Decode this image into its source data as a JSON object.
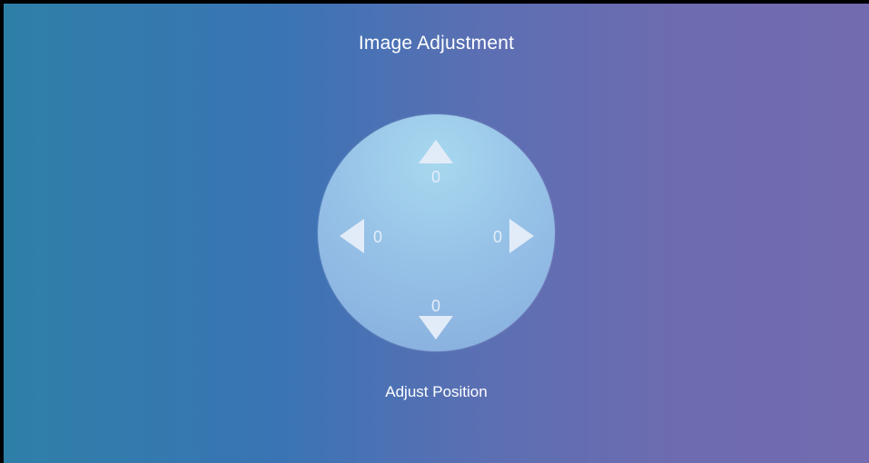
{
  "header": {
    "title": "Image Adjustment"
  },
  "position_pad": {
    "up_value": "0",
    "down_value": "0",
    "left_value": "0",
    "right_value": "0",
    "caption": "Adjust Position"
  },
  "icons": {
    "up": "triangle-up-icon",
    "down": "triangle-down-icon",
    "left": "triangle-left-icon",
    "right": "triangle-right-icon"
  },
  "colors": {
    "gradient_start": "#2e7fa8",
    "gradient_end": "#726bb0",
    "pad_fill": "#97c2e7",
    "arrow_fill": "#e2ecf8"
  }
}
